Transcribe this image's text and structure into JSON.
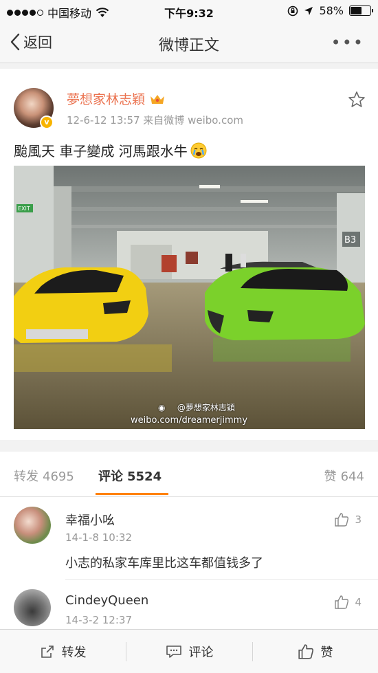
{
  "status_bar": {
    "carrier": "中国移动",
    "time": "下午9:32",
    "battery": "58%",
    "battery_level": 0.58
  },
  "nav": {
    "back_label": "返回",
    "title": "微博正文"
  },
  "post": {
    "author": "夢想家林志穎",
    "meta": "12-6-12 13:57  来自微博 weibo.com",
    "text": "颱風天 車子變成 河馬跟水牛",
    "watermark_handle": "@夢想家林志穎",
    "watermark_url": "weibo.com/dreamerjimmy",
    "photo_sign": "B3",
    "photo_exit": "EXIT"
  },
  "tabs": {
    "repost": {
      "label": "转发",
      "count": "4695"
    },
    "comment": {
      "label": "评论",
      "count": "5524"
    },
    "like": {
      "label": "赞",
      "count": "644"
    }
  },
  "comments": [
    {
      "name": "幸福小吆",
      "time": "14-1-8 10:32",
      "text": "小志的私家车库里比这车都值钱多了",
      "likes": "3"
    },
    {
      "name": "CindeyQueen",
      "time": "14-3-2 12:37",
      "text": "",
      "likes": "4"
    }
  ],
  "bottom_bar": {
    "repost": "转发",
    "comment": "评论",
    "like": "赞"
  },
  "colors": {
    "accent_orange": "#ff8200",
    "username_orange": "#eb7350"
  }
}
